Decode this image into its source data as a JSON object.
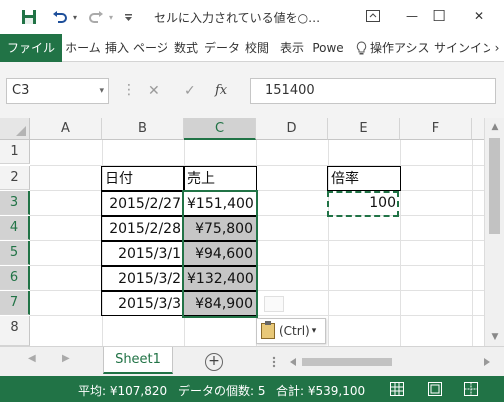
{
  "window": {
    "title": "セルに入力されている値を○…",
    "minimize": "—",
    "restore": "☐",
    "close": "✕"
  },
  "ribbon": {
    "tabs": [
      "ファイル",
      "ホーム",
      "挿入",
      "ページ",
      "数式",
      "データ",
      "校閲",
      "表示",
      "Powe"
    ],
    "tell_me": "操作アシス",
    "signin": "サインイン",
    "more": "›"
  },
  "formula_bar": {
    "name_box": "C3",
    "formula": "151400"
  },
  "columns": [
    "A",
    "B",
    "C",
    "D",
    "E",
    "F"
  ],
  "rows": [
    "1",
    "2",
    "3",
    "4",
    "5",
    "6",
    "7",
    "8"
  ],
  "cells": {
    "B2": "日付",
    "C2": "売上",
    "E2": "倍率",
    "E3": "100",
    "dates": [
      "2015/2/27",
      "2015/2/28",
      "2015/3/1",
      "2015/3/2",
      "2015/3/3"
    ],
    "sales": [
      "¥151,400",
      "¥75,800",
      "¥94,600",
      "¥132,400",
      "¥84,900"
    ]
  },
  "paste_options": {
    "label": "(Ctrl)",
    "arrow": "▾"
  },
  "sheets": {
    "active": "Sheet1",
    "add": "+"
  },
  "status_bar": {
    "average": "平均: ¥107,820",
    "count": "データの個数: 5",
    "sum": "合計: ¥539,100"
  },
  "colors": {
    "accent": "#217346",
    "selected_fill": "#c6c6c6"
  },
  "icons": [
    "save-icon",
    "undo-icon",
    "redo-icon",
    "customize-qat-icon",
    "ribbon-display-icon",
    "lightbulb-icon",
    "paste-clipboard-icon",
    "normal-view-icon",
    "page-layout-icon",
    "page-break-view-icon"
  ]
}
